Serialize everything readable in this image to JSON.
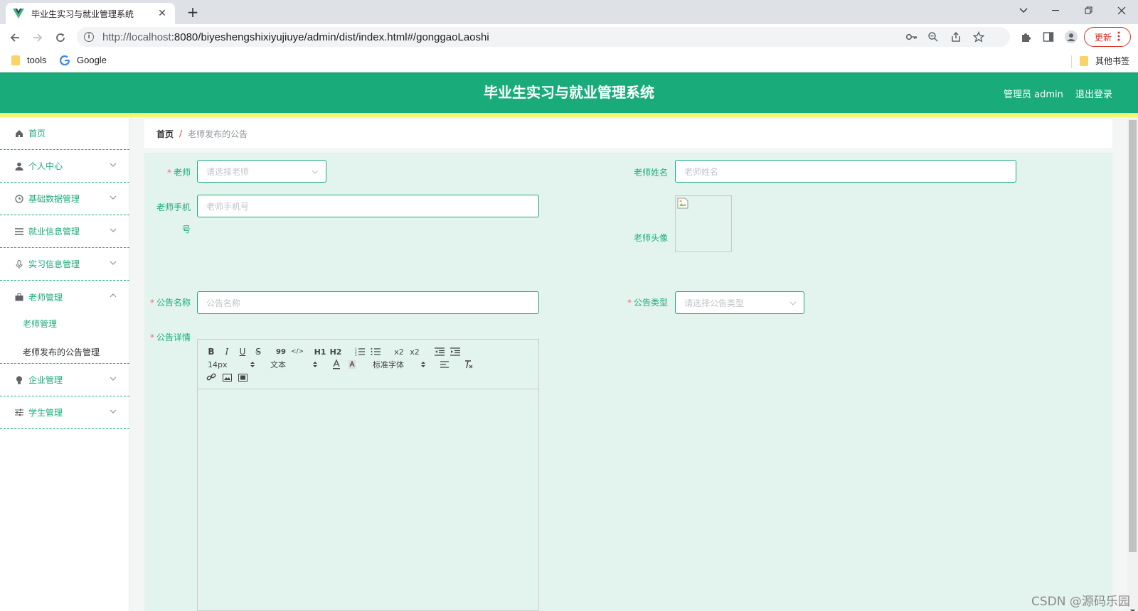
{
  "browser": {
    "tab_title": "毕业生实习与就业管理系统",
    "url_host": "http://localhost",
    "url_path": ":8080/biyeshengshixiyujiuye/admin/dist/index.html#/gonggaoLaoshi",
    "update_label": "更新",
    "bookmarks": [
      "tools",
      "Google"
    ],
    "other_bookmarks": "其他书签"
  },
  "header": {
    "title": "毕业生实习与就业管理系统",
    "admin": "管理员 admin",
    "logout": "退出登录"
  },
  "sidebar": {
    "items": [
      {
        "label": "首页",
        "icon": "home-icon"
      },
      {
        "label": "个人中心",
        "icon": "user-icon"
      },
      {
        "label": "基础数据管理",
        "icon": "clock-icon"
      },
      {
        "label": "就业信息管理",
        "icon": "list-icon"
      },
      {
        "label": "实习信息管理",
        "icon": "mic-icon"
      },
      {
        "label": "老师管理",
        "icon": "suitcase-icon"
      },
      {
        "label": "企业管理",
        "icon": "bulb-icon"
      },
      {
        "label": "学生管理",
        "icon": "sliders-icon"
      }
    ],
    "sub_items": [
      "老师管理",
      "老师发布的公告管理"
    ]
  },
  "breadcrumb": {
    "home": "首页",
    "sep": "/",
    "current": "老师发布的公告"
  },
  "form": {
    "teacher_label": "老师",
    "teacher_placeholder": "请选择老师",
    "teacher_name_label": "老师姓名",
    "teacher_name_placeholder": "老师姓名",
    "teacher_phone_label_1": "老师手机",
    "teacher_phone_label_2": "号",
    "teacher_phone_placeholder": "老师手机号",
    "teacher_avatar_label": "老师头像",
    "notice_name_label": "公告名称",
    "notice_name_placeholder": "公告名称",
    "notice_type_label": "公告类型",
    "notice_type_placeholder": "请选择公告类型",
    "notice_detail_label": "公告详情",
    "required_mark": "*"
  },
  "editor": {
    "size": "14px",
    "header_picker": "文本",
    "font_picker": "标准字体",
    "buttons": [
      "B",
      "I",
      "U",
      "S",
      "99",
      "</>",
      "H1",
      "H2",
      "x2",
      "x2"
    ]
  },
  "watermark": "CSDN @源码乐园"
}
